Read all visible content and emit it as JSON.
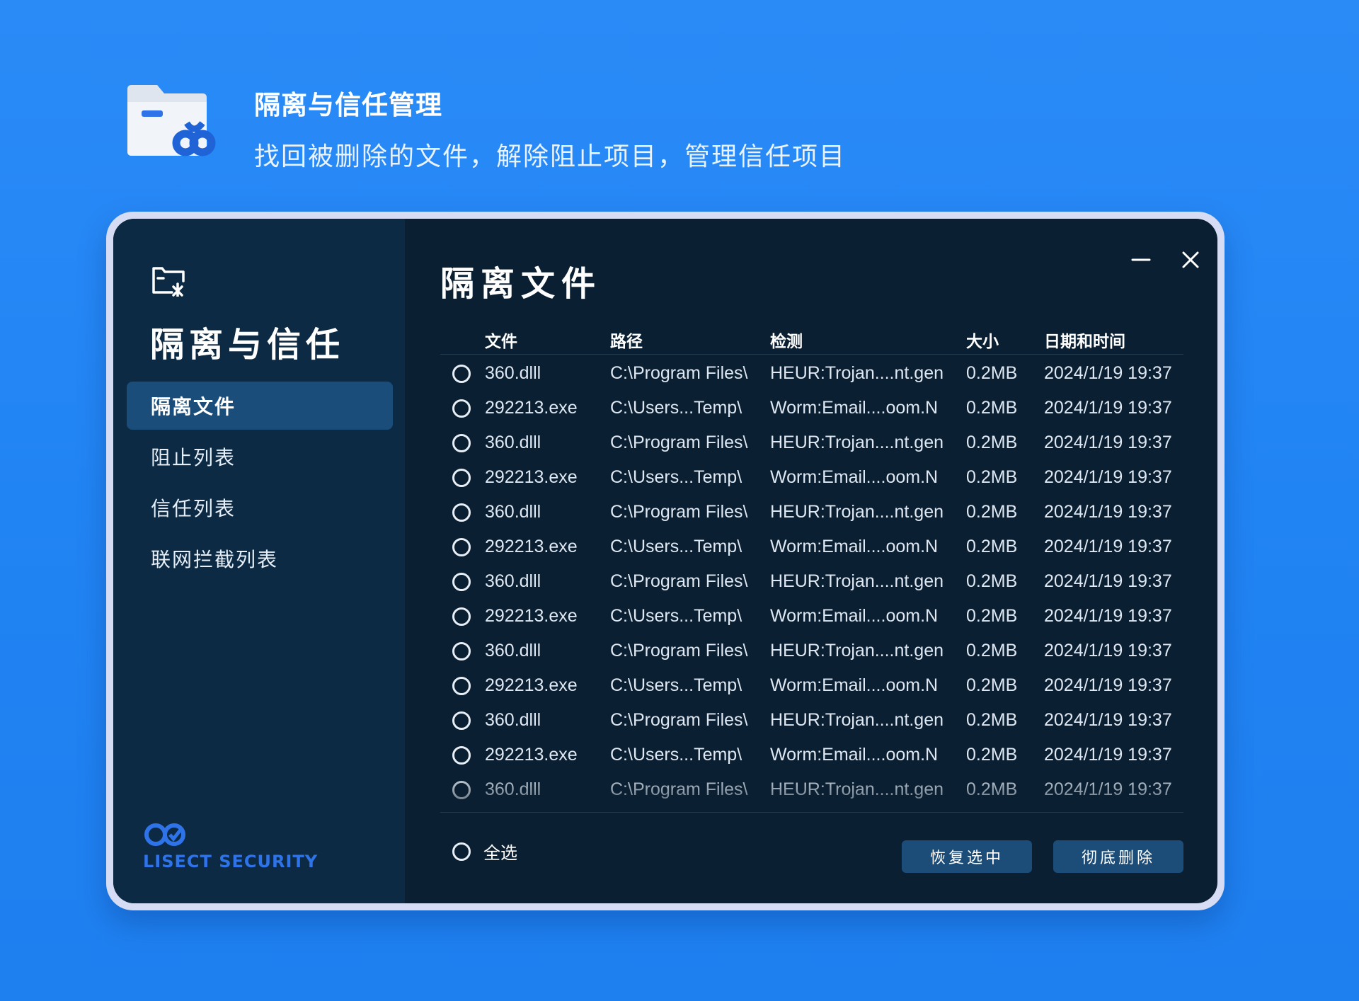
{
  "header": {
    "title": "隔离与信任管理",
    "subtitle": "找回被删除的文件，解除阻止项目，管理信任项目",
    "icon": "quarantine-folder-icon"
  },
  "colors": {
    "background": "#2184f3",
    "window": "#0a1f31",
    "sidebar": "#0c2a43",
    "active_nav": "#1b4d7a",
    "button": "#1c4c78",
    "brand": "#2f73e8"
  },
  "sidebar": {
    "title": "隔离与信任",
    "items": [
      {
        "label": "隔离文件",
        "active": true
      },
      {
        "label": "阻止列表",
        "active": false
      },
      {
        "label": "信任列表",
        "active": false
      },
      {
        "label": "联网拦截列表",
        "active": false
      }
    ],
    "brand": "LISECT SECURITY"
  },
  "main": {
    "title": "隔离文件",
    "columns": [
      "文件",
      "路径",
      "检测",
      "大小",
      "日期和时间"
    ],
    "rows": [
      {
        "file": "360.dlll",
        "path": "C:\\Program Files\\",
        "detect": "HEUR:Trojan....nt.gen",
        "size": "0.2MB",
        "date": "2024/1/19 19:37"
      },
      {
        "file": "292213.exe",
        "path": "C:\\Users...Temp\\",
        "detect": "Worm:Email....oom.N",
        "size": "0.2MB",
        "date": "2024/1/19 19:37"
      },
      {
        "file": "360.dlll",
        "path": "C:\\Program Files\\",
        "detect": "HEUR:Trojan....nt.gen",
        "size": "0.2MB",
        "date": "2024/1/19 19:37"
      },
      {
        "file": "292213.exe",
        "path": "C:\\Users...Temp\\",
        "detect": "Worm:Email....oom.N",
        "size": "0.2MB",
        "date": "2024/1/19 19:37"
      },
      {
        "file": "360.dlll",
        "path": "C:\\Program Files\\",
        "detect": "HEUR:Trojan....nt.gen",
        "size": "0.2MB",
        "date": "2024/1/19 19:37"
      },
      {
        "file": "292213.exe",
        "path": "C:\\Users...Temp\\",
        "detect": "Worm:Email....oom.N",
        "size": "0.2MB",
        "date": "2024/1/19 19:37"
      },
      {
        "file": "360.dlll",
        "path": "C:\\Program Files\\",
        "detect": "HEUR:Trojan....nt.gen",
        "size": "0.2MB",
        "date": "2024/1/19 19:37"
      },
      {
        "file": "292213.exe",
        "path": "C:\\Users...Temp\\",
        "detect": "Worm:Email....oom.N",
        "size": "0.2MB",
        "date": "2024/1/19 19:37"
      },
      {
        "file": "360.dlll",
        "path": "C:\\Program Files\\",
        "detect": "HEUR:Trojan....nt.gen",
        "size": "0.2MB",
        "date": "2024/1/19 19:37"
      },
      {
        "file": "292213.exe",
        "path": "C:\\Users...Temp\\",
        "detect": "Worm:Email....oom.N",
        "size": "0.2MB",
        "date": "2024/1/19 19:37"
      },
      {
        "file": "360.dlll",
        "path": "C:\\Program Files\\",
        "detect": "HEUR:Trojan....nt.gen",
        "size": "0.2MB",
        "date": "2024/1/19 19:37"
      },
      {
        "file": "292213.exe",
        "path": "C:\\Users...Temp\\",
        "detect": "Worm:Email....oom.N",
        "size": "0.2MB",
        "date": "2024/1/19 19:37"
      },
      {
        "file": "360.dlll",
        "path": "C:\\Program Files\\",
        "detect": "HEUR:Trojan....nt.gen",
        "size": "0.2MB",
        "date": "2024/1/19 19:37"
      }
    ],
    "select_all_label": "全选",
    "restore_button": "恢复选中",
    "delete_button": "彻底删除"
  }
}
